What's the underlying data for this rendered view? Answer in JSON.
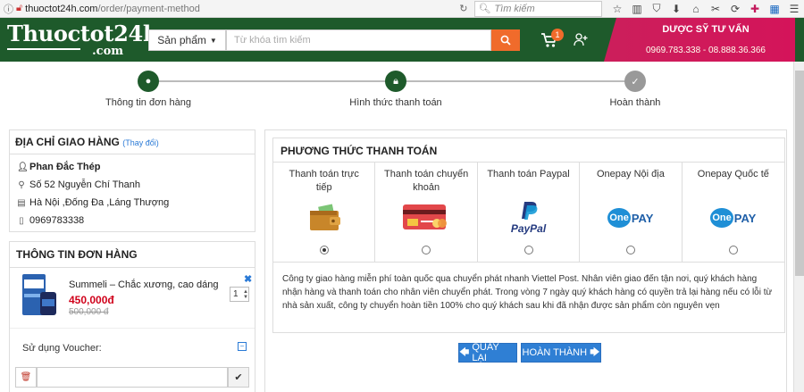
{
  "browser": {
    "url_host": "thuoctot24h.com",
    "url_path": "/order/payment-method",
    "search_placeholder": "Tìm kiếm",
    "info_icon": "info-icon",
    "reload_icon": "reload-icon"
  },
  "header": {
    "logo_main": "Thuoctot24h",
    "logo_sub": ".com",
    "category_label": "Sản phẩm",
    "search_placeholder": "Từ khóa tìm kiếm",
    "cart_count": "1",
    "advisor_title": "DƯỢC SỸ TƯ VẤN",
    "advisor_phones": "0969.783.338 - 08.888.36.366"
  },
  "steps": [
    {
      "label": "Thông tin đơn hàng",
      "state": "done"
    },
    {
      "label": "Hình thức thanh toán",
      "state": "active"
    },
    {
      "label": "Hoàn thành",
      "state": "pending"
    }
  ],
  "address": {
    "title": "ĐỊA CHỈ GIAO HÀNG",
    "change_link": "(Thay đổi)",
    "name": "Phan Đắc Thép",
    "street": "Số 52 Nguyễn Chí Thanh",
    "area": "Hà Nội ,Đống Đa ,Láng Thượng",
    "phone": "0969783338"
  },
  "order": {
    "title": "THÔNG TIN ĐƠN HÀNG",
    "product_name": "Summeli – Chắc xương, cao dáng",
    "price": "450,000đ",
    "old_price": "500,000 đ",
    "quantity": "1",
    "voucher_label": "Sử dụng Voucher:"
  },
  "payment": {
    "title": "PHƯƠNG THỨC THANH TOÁN",
    "methods": [
      {
        "label": "Thanh toán trực tiếp",
        "selected": true,
        "icon": "wallet-icon"
      },
      {
        "label": "Thanh toán chuyển khoản",
        "selected": false,
        "icon": "bank-card-icon"
      },
      {
        "label": "Thanh toán Paypal",
        "selected": false,
        "icon": "paypal-icon"
      },
      {
        "label": "Onepay Nội địa",
        "selected": false,
        "icon": "onepay-icon"
      },
      {
        "label": "Onepay Quốc tế",
        "selected": false,
        "icon": "onepay-icon"
      }
    ],
    "paypal_text": "PayPal",
    "onepay_text_one": "One",
    "onepay_text_pay": "PAY",
    "description": "Công ty giao hàng miễn phí toàn quốc qua chuyển phát nhanh Viettel Post. Nhân viên giao đến tận nơi, quý khách hàng nhận hàng và thanh toán cho nhân viên chuyển phát. Trong vòng 7 ngày quý khách hàng có quyền trả lại hàng nếu có lỗi từ nhà sản xuất, công ty chuyển hoàn tiền 100% cho quý khách sau khi đã nhận được sản phẩm còn nguyên vẹn",
    "back_label": "QUAY LẠI",
    "finish_label": "HOÀN THÀNH"
  },
  "colors": {
    "header_green": "#1e5a2b",
    "accent_orange": "#f06b2b",
    "advisor_pink": "#d4145a",
    "button_blue": "#2f7fd4",
    "price_red": "#d0021b"
  }
}
